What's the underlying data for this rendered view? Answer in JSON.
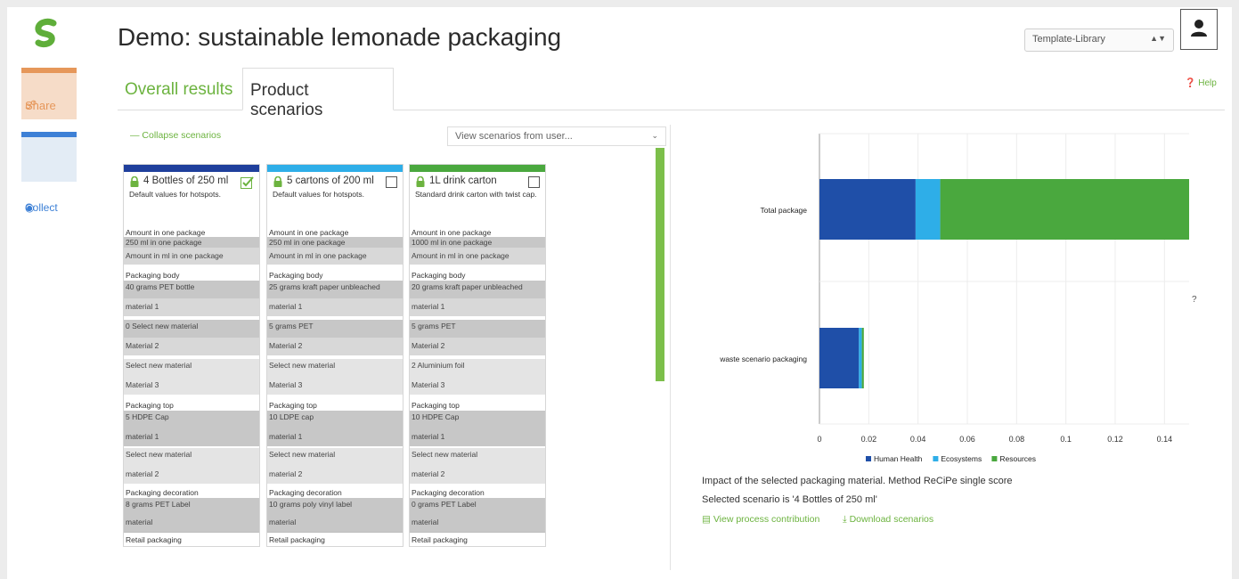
{
  "app": {
    "title": "Demo: sustainable lemonade packaging",
    "template_select": "Template-Library",
    "help": "Help"
  },
  "rail": {
    "share": "Share",
    "collect": "Collect"
  },
  "tabs": {
    "overall": "Overall results",
    "product": "Product scenarios"
  },
  "toolbar": {
    "collapse": "Collapse scenarios",
    "view_users": "View scenarios from user..."
  },
  "colors": {
    "accent": "#6cb33f",
    "share": "#e6975a",
    "collect": "#3d80d6",
    "human_health": "#1f4fa8",
    "ecosystems": "#2eaee8",
    "resources": "#4aa83e"
  },
  "scenarios": [
    {
      "name": "4 Bottles of 250 ml",
      "checked": true,
      "band_color": "#1f3f9c",
      "description": "Default values for hotspots.",
      "amount_label": "Amount in one package",
      "amount_value": "250 ml in one package",
      "amount_unit": "Amount in ml in one package",
      "body_label": "Packaging body",
      "body_materials": [
        {
          "value": "40 grams PET bottle",
          "name": "material 1"
        },
        {
          "value": "0 Select new material",
          "name": "Material 2"
        },
        {
          "value": "Select new material",
          "name": "Material 3"
        }
      ],
      "top_label": "Packaging top",
      "top_materials": [
        {
          "value": "5 HDPE Cap",
          "name": "material 1"
        },
        {
          "value": "Select new material",
          "name": "material 2"
        }
      ],
      "decoration_label": "Packaging decoration",
      "decoration": {
        "value": "8 grams PET Label",
        "name": "material"
      },
      "retail_label": "Retail packaging"
    },
    {
      "name": "5 cartons of 200 ml",
      "checked": false,
      "band_color": "#2eaee8",
      "description": "Default values for hotspots.",
      "amount_label": "Amount in one package",
      "amount_value": "250 ml in one package",
      "amount_unit": "Amount in ml in one package",
      "body_label": "Packaging body",
      "body_materials": [
        {
          "value": "25 grams kraft paper unbleached",
          "name": "material 1"
        },
        {
          "value": "5 grams PET",
          "name": "Material 2"
        },
        {
          "value": "Select new material",
          "name": "Material 3"
        }
      ],
      "top_label": "Packaging top",
      "top_materials": [
        {
          "value": "10 LDPE cap",
          "name": "material 1"
        },
        {
          "value": "Select new material",
          "name": "material 2"
        }
      ],
      "decoration_label": "Packaging decoration",
      "decoration": {
        "value": "10 grams poly vinyl label",
        "name": "material"
      },
      "retail_label": "Retail packaging"
    },
    {
      "name": "1L drink carton",
      "checked": false,
      "band_color": "#4aa83e",
      "description": "Standard drink carton with twist cap.",
      "amount_label": "Amount in one package",
      "amount_value": "1000 ml in one package",
      "amount_unit": "Amount in ml in one package",
      "body_label": "Packaging body",
      "body_materials": [
        {
          "value": "20 grams kraft paper unbleached",
          "name": "material 1"
        },
        {
          "value": "5 grams PET",
          "name": "Material 2"
        },
        {
          "value": "2 Aluminium foil",
          "name": "Material 3"
        }
      ],
      "top_label": "Packaging top",
      "top_materials": [
        {
          "value": "10 HDPE Cap",
          "name": "material 1"
        },
        {
          "value": "Select new material",
          "name": "material 2"
        }
      ],
      "decoration_label": "Packaging decoration",
      "decoration": {
        "value": "0 grams PET Label",
        "name": "material"
      },
      "retail_label": "Retail packaging"
    }
  ],
  "chart_data": {
    "type": "bar",
    "orientation": "horizontal",
    "stacked": true,
    "categories": [
      "Total package",
      "waste scenario packaging"
    ],
    "series": [
      {
        "name": "Human Health",
        "color": "#1f4fa8",
        "values": [
          0.039,
          0.016
        ]
      },
      {
        "name": "Ecosystems",
        "color": "#2eaee8",
        "values": [
          0.01,
          0.0012
        ]
      },
      {
        "name": "Resources",
        "color": "#4aa83e",
        "values": [
          0.101,
          0.0008
        ]
      }
    ],
    "xlim": [
      0,
      0.15
    ],
    "xticks": [
      "0",
      "0.02",
      "0.04",
      "0.06",
      "0.08",
      "0.1",
      "0.12",
      "0.14"
    ],
    "grid": true,
    "legend": "bottom",
    "annotation": "?"
  },
  "footer": {
    "caption": "Impact of the selected packaging material. Method ReCiPe single score",
    "selected": "Selected scenario is '4 Bottles of 250 ml'",
    "view_process": "View process contribution",
    "download": "Download scenarios"
  }
}
